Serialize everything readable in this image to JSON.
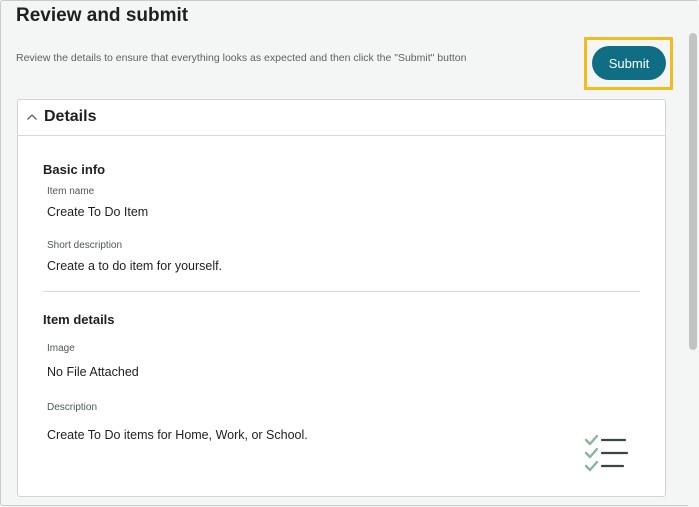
{
  "page": {
    "title": "Review and submit",
    "instructions": "Review the details to ensure that everything looks as expected and then click the \"Submit\" button"
  },
  "actions": {
    "submit_label": "Submit"
  },
  "details": {
    "title": "Details",
    "collapse_icon": "chevron-up-icon",
    "basic_info": {
      "title": "Basic info",
      "item_name_label": "Item name",
      "item_name_value": "Create To Do Item",
      "short_description_label": "Short description",
      "short_description_value": "Create a to do item for yourself."
    },
    "item_details": {
      "title": "Item details",
      "image_label": "Image",
      "image_value": "No File Attached",
      "description_label": "Description",
      "description_value": "Create To Do items for Home, Work, or School.",
      "description_icon": "checklist-icon"
    }
  },
  "colors": {
    "accent": "#0f6e84",
    "highlight": "#f2bd1c",
    "check_green": "#8ab69a",
    "list_gray": "#3c4446"
  }
}
